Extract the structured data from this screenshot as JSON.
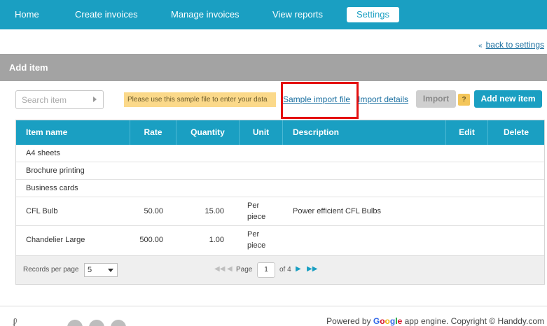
{
  "nav": {
    "items": [
      {
        "label": "Home",
        "active": false
      },
      {
        "label": "Create invoices",
        "active": false
      },
      {
        "label": "Manage invoices",
        "active": false
      },
      {
        "label": "View reports",
        "active": false
      },
      {
        "label": "Settings",
        "active": true
      }
    ]
  },
  "back_link": "back to settings",
  "section": {
    "title": "Add item"
  },
  "toolbar": {
    "search_placeholder": "Search item",
    "hint": "Please use this sample file to enter your data",
    "sample_link": "Sample import file",
    "import_details": "Import details",
    "import_button": "Import",
    "help_icon": "?",
    "add_button": "Add new item"
  },
  "table": {
    "headers": [
      "Item name",
      "Rate",
      "Quantity",
      "Unit",
      "Description",
      "Edit",
      "Delete"
    ],
    "rows": [
      {
        "name": "A4 sheets",
        "rate": "",
        "quantity": "",
        "unit_line1": "",
        "unit_line2": "",
        "description": ""
      },
      {
        "name": "Brochure printing",
        "rate": "",
        "quantity": "",
        "unit_line1": "",
        "unit_line2": "",
        "description": ""
      },
      {
        "name": "Business cards",
        "rate": "",
        "quantity": "",
        "unit_line1": "",
        "unit_line2": "",
        "description": ""
      },
      {
        "name": "CFL Bulb",
        "rate": "50.00",
        "quantity": "15.00",
        "unit_line1": "Per",
        "unit_line2": "piece",
        "description": "Power efficient CFL Bulbs"
      },
      {
        "name": "Chandelier Large",
        "rate": "500.00",
        "quantity": "1.00",
        "unit_line1": "Per",
        "unit_line2": "piece",
        "description": ""
      }
    ]
  },
  "pager": {
    "records_label": "Records per page",
    "records_value": "5",
    "page_label": "Page",
    "page_value": "1",
    "of_label": "of 4"
  },
  "footer": {
    "powered_by": "Powered by ",
    "google": [
      "G",
      "o",
      "o",
      "g",
      "l",
      "e"
    ],
    "rest": " app engine. Copyright © Handdy.com"
  },
  "colors": {
    "accent": "#1a9fc2",
    "highlight": "#e41010",
    "hint_bg": "#fbd98a"
  }
}
